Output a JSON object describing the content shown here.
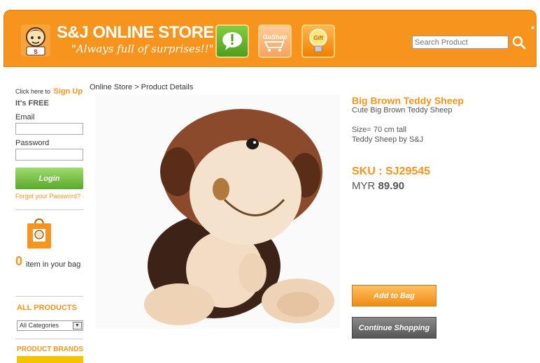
{
  "header": {
    "title": "S&J ONLINE STORE",
    "tagline": "\"Always full of surprises!!\"",
    "icons": [
      "speech-bubble-icon",
      "goshop-cart-icon",
      "gift-bulb-icon"
    ],
    "goshop_label": "GoShop",
    "gift_label": "Gift",
    "search_placeholder": "Search Product",
    "accent": "#f7941d"
  },
  "sidebar": {
    "click_here": "Click here to",
    "signup": "Sign Up",
    "free": "It's FREE",
    "email_label": "Email",
    "password_label": "Password",
    "login": "Login",
    "forgot": "Forgot your Password?",
    "bag_count": "0",
    "bag_text": "item in your bag",
    "all_products": "ALL PRODUCTS",
    "category_selected": "All Categories",
    "product_brands": "PRODUCT BRANDS"
  },
  "main": {
    "breadcrumb": "Online Store > Product Details"
  },
  "product": {
    "name": "Big Brown Teddy Sheep",
    "subtitle": "Cute Big Brown Teddy Sheep",
    "size": "Size= 70 cm tall",
    "brand": "Teddy Sheep by S&J",
    "sku": "SKU : SJ29545",
    "currency": "MYR",
    "price": "89.90",
    "add_to_bag": "Add to Bag",
    "continue_shopping": "Continue Shopping"
  }
}
